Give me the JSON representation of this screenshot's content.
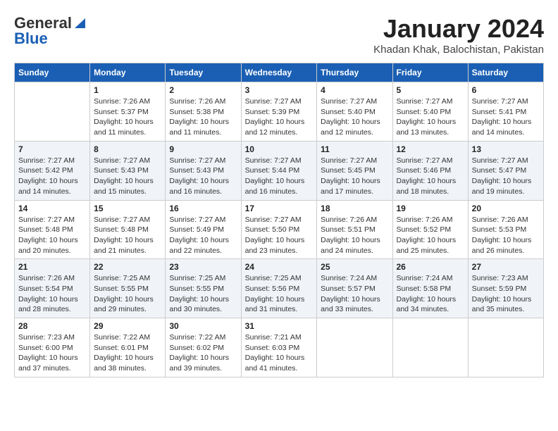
{
  "header": {
    "logo_general": "General",
    "logo_blue": "Blue",
    "month_title": "January 2024",
    "location": "Khadan Khak, Balochistan, Pakistan"
  },
  "weekdays": [
    "Sunday",
    "Monday",
    "Tuesday",
    "Wednesday",
    "Thursday",
    "Friday",
    "Saturday"
  ],
  "weeks": [
    [
      {
        "day": "",
        "info": ""
      },
      {
        "day": "1",
        "info": "Sunrise: 7:26 AM\nSunset: 5:37 PM\nDaylight: 10 hours\nand 11 minutes."
      },
      {
        "day": "2",
        "info": "Sunrise: 7:26 AM\nSunset: 5:38 PM\nDaylight: 10 hours\nand 11 minutes."
      },
      {
        "day": "3",
        "info": "Sunrise: 7:27 AM\nSunset: 5:39 PM\nDaylight: 10 hours\nand 12 minutes."
      },
      {
        "day": "4",
        "info": "Sunrise: 7:27 AM\nSunset: 5:40 PM\nDaylight: 10 hours\nand 12 minutes."
      },
      {
        "day": "5",
        "info": "Sunrise: 7:27 AM\nSunset: 5:40 PM\nDaylight: 10 hours\nand 13 minutes."
      },
      {
        "day": "6",
        "info": "Sunrise: 7:27 AM\nSunset: 5:41 PM\nDaylight: 10 hours\nand 14 minutes."
      }
    ],
    [
      {
        "day": "7",
        "info": "Sunrise: 7:27 AM\nSunset: 5:42 PM\nDaylight: 10 hours\nand 14 minutes."
      },
      {
        "day": "8",
        "info": "Sunrise: 7:27 AM\nSunset: 5:43 PM\nDaylight: 10 hours\nand 15 minutes."
      },
      {
        "day": "9",
        "info": "Sunrise: 7:27 AM\nSunset: 5:43 PM\nDaylight: 10 hours\nand 16 minutes."
      },
      {
        "day": "10",
        "info": "Sunrise: 7:27 AM\nSunset: 5:44 PM\nDaylight: 10 hours\nand 16 minutes."
      },
      {
        "day": "11",
        "info": "Sunrise: 7:27 AM\nSunset: 5:45 PM\nDaylight: 10 hours\nand 17 minutes."
      },
      {
        "day": "12",
        "info": "Sunrise: 7:27 AM\nSunset: 5:46 PM\nDaylight: 10 hours\nand 18 minutes."
      },
      {
        "day": "13",
        "info": "Sunrise: 7:27 AM\nSunset: 5:47 PM\nDaylight: 10 hours\nand 19 minutes."
      }
    ],
    [
      {
        "day": "14",
        "info": "Sunrise: 7:27 AM\nSunset: 5:48 PM\nDaylight: 10 hours\nand 20 minutes."
      },
      {
        "day": "15",
        "info": "Sunrise: 7:27 AM\nSunset: 5:48 PM\nDaylight: 10 hours\nand 21 minutes."
      },
      {
        "day": "16",
        "info": "Sunrise: 7:27 AM\nSunset: 5:49 PM\nDaylight: 10 hours\nand 22 minutes."
      },
      {
        "day": "17",
        "info": "Sunrise: 7:27 AM\nSunset: 5:50 PM\nDaylight: 10 hours\nand 23 minutes."
      },
      {
        "day": "18",
        "info": "Sunrise: 7:26 AM\nSunset: 5:51 PM\nDaylight: 10 hours\nand 24 minutes."
      },
      {
        "day": "19",
        "info": "Sunrise: 7:26 AM\nSunset: 5:52 PM\nDaylight: 10 hours\nand 25 minutes."
      },
      {
        "day": "20",
        "info": "Sunrise: 7:26 AM\nSunset: 5:53 PM\nDaylight: 10 hours\nand 26 minutes."
      }
    ],
    [
      {
        "day": "21",
        "info": "Sunrise: 7:26 AM\nSunset: 5:54 PM\nDaylight: 10 hours\nand 28 minutes."
      },
      {
        "day": "22",
        "info": "Sunrise: 7:25 AM\nSunset: 5:55 PM\nDaylight: 10 hours\nand 29 minutes."
      },
      {
        "day": "23",
        "info": "Sunrise: 7:25 AM\nSunset: 5:55 PM\nDaylight: 10 hours\nand 30 minutes."
      },
      {
        "day": "24",
        "info": "Sunrise: 7:25 AM\nSunset: 5:56 PM\nDaylight: 10 hours\nand 31 minutes."
      },
      {
        "day": "25",
        "info": "Sunrise: 7:24 AM\nSunset: 5:57 PM\nDaylight: 10 hours\nand 33 minutes."
      },
      {
        "day": "26",
        "info": "Sunrise: 7:24 AM\nSunset: 5:58 PM\nDaylight: 10 hours\nand 34 minutes."
      },
      {
        "day": "27",
        "info": "Sunrise: 7:23 AM\nSunset: 5:59 PM\nDaylight: 10 hours\nand 35 minutes."
      }
    ],
    [
      {
        "day": "28",
        "info": "Sunrise: 7:23 AM\nSunset: 6:00 PM\nDaylight: 10 hours\nand 37 minutes."
      },
      {
        "day": "29",
        "info": "Sunrise: 7:22 AM\nSunset: 6:01 PM\nDaylight: 10 hours\nand 38 minutes."
      },
      {
        "day": "30",
        "info": "Sunrise: 7:22 AM\nSunset: 6:02 PM\nDaylight: 10 hours\nand 39 minutes."
      },
      {
        "day": "31",
        "info": "Sunrise: 7:21 AM\nSunset: 6:03 PM\nDaylight: 10 hours\nand 41 minutes."
      },
      {
        "day": "",
        "info": ""
      },
      {
        "day": "",
        "info": ""
      },
      {
        "day": "",
        "info": ""
      }
    ]
  ]
}
